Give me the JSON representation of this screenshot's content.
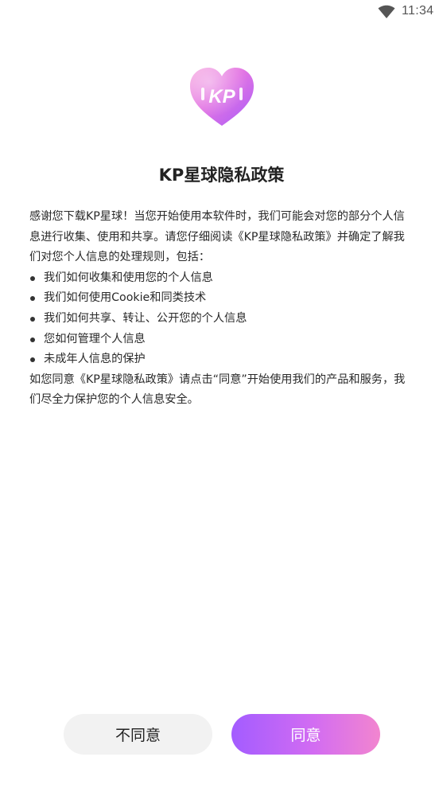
{
  "status_bar": {
    "time": "11:34"
  },
  "logo": {
    "text": "KP",
    "colors": [
      "#f58fd6",
      "#c66af0",
      "#9f5cff"
    ]
  },
  "dialog": {
    "title": "KP星球隐私政策",
    "intro": "感谢您下载KP星球！当您开始使用本软件时，我们可能会对您的部分个人信息进行收集、使用和共享。请您仔细阅读《KP星球隐私政策》并确定了解我们对您个人信息的处理规则，包括：",
    "bullets": [
      "我们如何收集和使用您的个人信息",
      "我们如何使用Cookie和同类技术",
      "我们如何共享、转让、公开您的个人信息",
      "您如何管理个人信息",
      "未成年人信息的保护"
    ],
    "outro": "如您同意《KP星球隐私政策》请点击“同意”开始使用我们的产品和服务，我们尽全力保护您的个人信息安全。"
  },
  "buttons": {
    "decline_label": "不同意",
    "agree_label": "同意"
  },
  "colors": {
    "agree_gradient_start": "#a35cff",
    "agree_gradient_end": "#f285cf",
    "decline_bg": "#f2f2f2"
  }
}
